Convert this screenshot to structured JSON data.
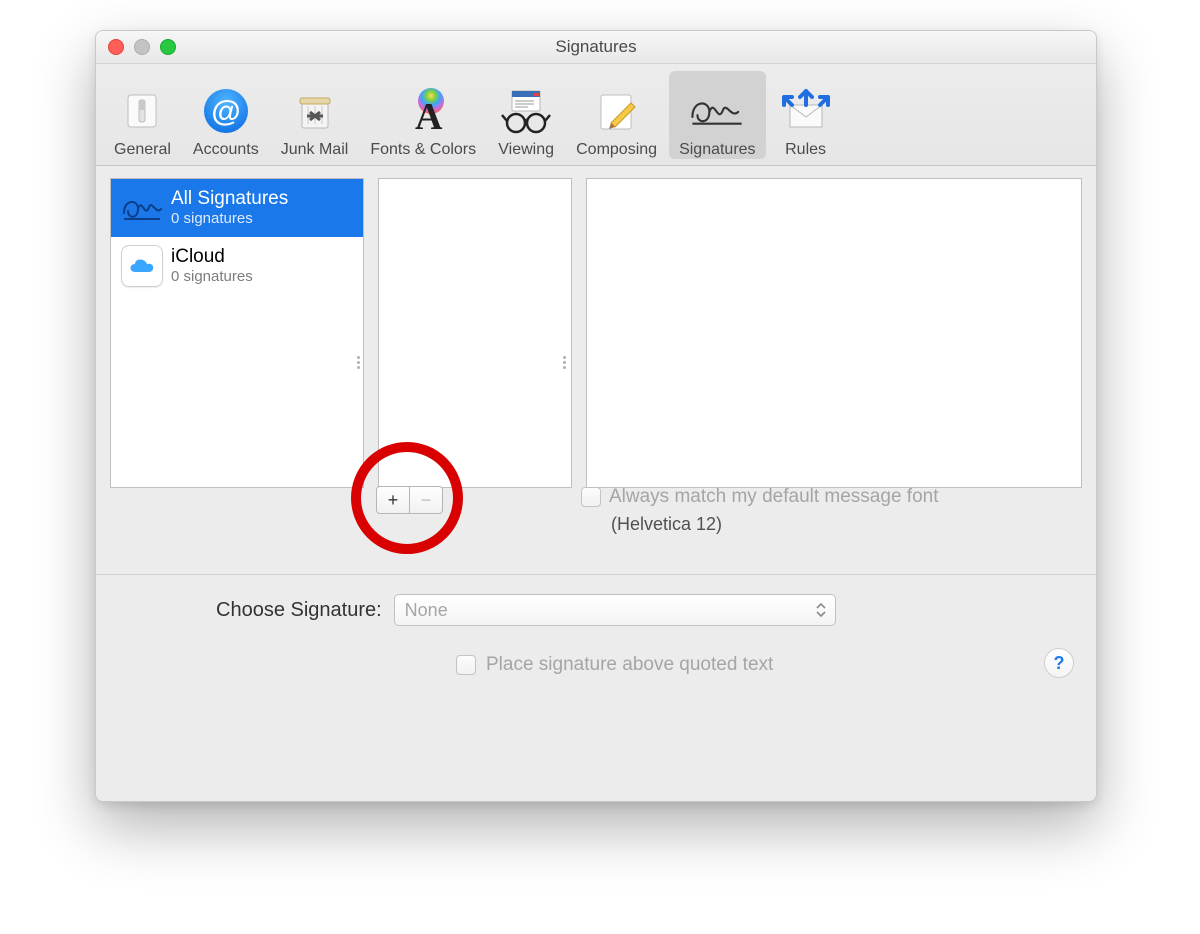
{
  "window": {
    "title": "Signatures"
  },
  "toolbar": {
    "items": [
      {
        "id": "general",
        "label": "General"
      },
      {
        "id": "accounts",
        "label": "Accounts"
      },
      {
        "id": "junk",
        "label": "Junk Mail"
      },
      {
        "id": "fonts",
        "label": "Fonts & Colors"
      },
      {
        "id": "viewing",
        "label": "Viewing"
      },
      {
        "id": "composing",
        "label": "Composing"
      },
      {
        "id": "signatures",
        "label": "Signatures",
        "selected": true
      },
      {
        "id": "rules",
        "label": "Rules"
      }
    ]
  },
  "accounts": [
    {
      "id": "all",
      "title": "All Signatures",
      "subtitle": "0 signatures",
      "selected": true
    },
    {
      "id": "icloud",
      "title": "iCloud",
      "subtitle": "0 signatures"
    }
  ],
  "buttons": {
    "add": "+",
    "remove": "−"
  },
  "match_font": {
    "label": "Always match my default message font",
    "font": "(Helvetica 12)",
    "checked": false,
    "enabled": false
  },
  "choose": {
    "label": "Choose Signature:",
    "value": "None"
  },
  "place_above": {
    "label": "Place signature above quoted text",
    "checked": false,
    "enabled": false
  },
  "help": "?"
}
